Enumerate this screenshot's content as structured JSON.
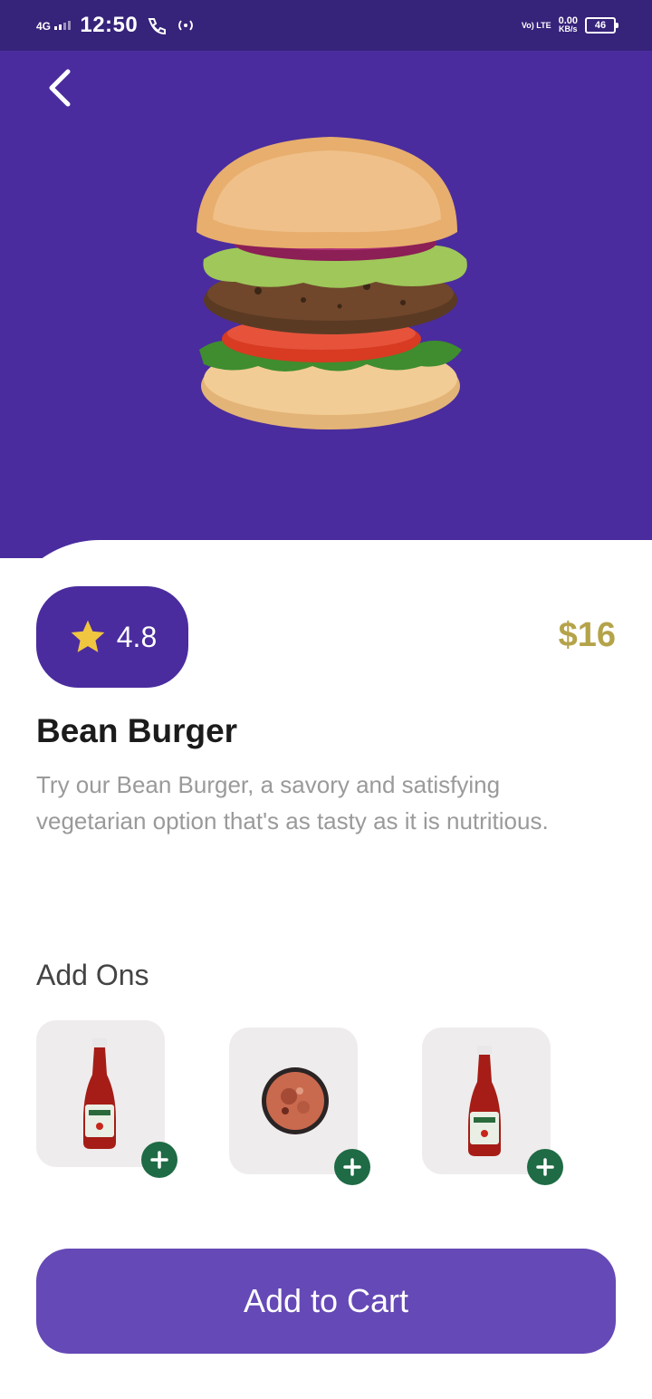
{
  "status_bar": {
    "network": "4G",
    "time": "12:50",
    "volte": "Vo) LTE",
    "speed_value": "0.00",
    "speed_unit": "KB/s",
    "battery": "46"
  },
  "product": {
    "name": "Bean Burger",
    "rating": "4.8",
    "price": "$16",
    "description": "Try our Bean Burger, a savory and satisfying vegetarian option that's as tasty as it is nutritious.",
    "image_icon": "burger-image"
  },
  "addons": {
    "title": "Add Ons",
    "items": [
      {
        "icon": "ketchup-bottle-icon"
      },
      {
        "icon": "sauce-bowl-icon"
      },
      {
        "icon": "ketchup-bottle-icon"
      }
    ]
  },
  "cart": {
    "label": "Add to Cart"
  },
  "colors": {
    "primary": "#4a2c9e",
    "status_bar": "#36237a",
    "price": "#b5a34a",
    "addon_plus": "#1e6b45",
    "button": "#6549b6"
  }
}
